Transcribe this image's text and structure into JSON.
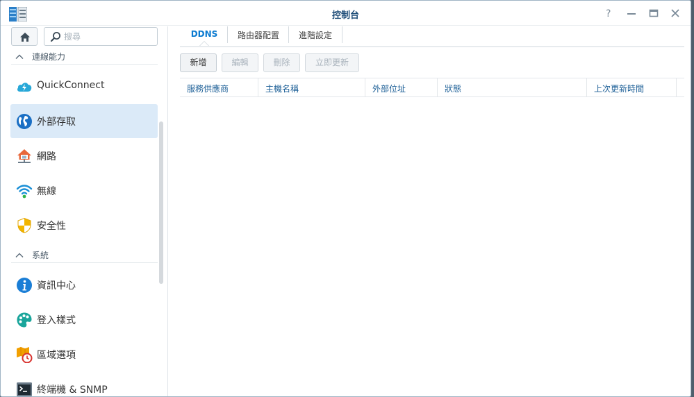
{
  "window": {
    "title": "控制台"
  },
  "search": {
    "placeholder": "搜尋"
  },
  "sidebar": {
    "sections": [
      {
        "label": "連線能力"
      },
      {
        "label": "系統"
      }
    ],
    "items": [
      {
        "label": "QuickConnect",
        "icon": "quickconnect-icon"
      },
      {
        "label": "外部存取",
        "icon": "globe-icon",
        "active": true
      },
      {
        "label": "網路",
        "icon": "network-house-icon"
      },
      {
        "label": "無線",
        "icon": "wifi-icon"
      },
      {
        "label": "安全性",
        "icon": "shield-icon"
      },
      {
        "label": "資訊中心",
        "icon": "info-icon"
      },
      {
        "label": "登入樣式",
        "icon": "palette-icon"
      },
      {
        "label": "區域選項",
        "icon": "map-clock-icon"
      },
      {
        "label": "終端機 & SNMP",
        "icon": "terminal-icon"
      }
    ]
  },
  "tabs": [
    {
      "label": "DDNS",
      "active": true
    },
    {
      "label": "路由器配置"
    },
    {
      "label": "進階設定"
    }
  ],
  "toolbar": {
    "add": "新增",
    "edit": "編輯",
    "delete": "刪除",
    "update_now": "立即更新"
  },
  "table": {
    "columns": [
      "服務供應商",
      "主機名稱",
      "外部位址",
      "狀態",
      "上次更新時間"
    ],
    "rows": []
  },
  "colors": {
    "accent": "#0a7ad0",
    "active_item_bg": "#dbeaf8",
    "header_text": "#1b5e96"
  }
}
